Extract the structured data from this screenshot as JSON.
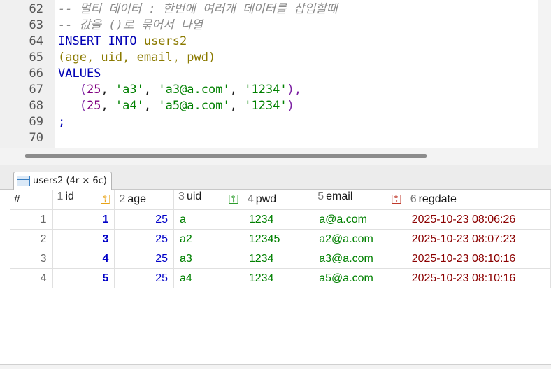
{
  "editor": {
    "lines": [
      {
        "num": "62",
        "parts": [
          {
            "t": "-- 멀티 데이터 : 한번에 여러개 데이터를 삽입할때",
            "c": "cm"
          }
        ]
      },
      {
        "num": "63",
        "parts": [
          {
            "t": "-- 값을 ()로 묶어서 나열",
            "c": "cm"
          }
        ]
      },
      {
        "num": "64",
        "parts": [
          {
            "t": "INSERT INTO ",
            "c": "kw"
          },
          {
            "t": "users2",
            "c": "id"
          }
        ]
      },
      {
        "num": "65",
        "parts": [
          {
            "t": "(",
            "c": "id"
          },
          {
            "t": "age, uid, email, pwd",
            "c": "id"
          },
          {
            "t": ")",
            "c": "id"
          }
        ]
      },
      {
        "num": "66",
        "parts": [
          {
            "t": "VALUES",
            "c": "kw"
          }
        ]
      },
      {
        "num": "67",
        "parts": [
          {
            "t": "   (",
            "c": "pn"
          },
          {
            "t": "25",
            "c": "nm"
          },
          {
            "t": ", ",
            "c": "bl"
          },
          {
            "t": "'a3'",
            "c": "st"
          },
          {
            "t": ", ",
            "c": "bl"
          },
          {
            "t": "'a3@a.com'",
            "c": "st"
          },
          {
            "t": ", ",
            "c": "bl"
          },
          {
            "t": "'1234'",
            "c": "st"
          },
          {
            "t": "),",
            "c": "pn"
          }
        ]
      },
      {
        "num": "68",
        "parts": [
          {
            "t": "   (",
            "c": "pn"
          },
          {
            "t": "25",
            "c": "nm"
          },
          {
            "t": ", ",
            "c": "bl"
          },
          {
            "t": "'a4'",
            "c": "st"
          },
          {
            "t": ", ",
            "c": "bl"
          },
          {
            "t": "'a5@a.com'",
            "c": "st"
          },
          {
            "t": ", ",
            "c": "bl"
          },
          {
            "t": "'1234'",
            "c": "st"
          },
          {
            "t": ")",
            "c": "pn"
          }
        ]
      },
      {
        "num": "69",
        "parts": [
          {
            "t": ";",
            "c": "kw"
          }
        ]
      },
      {
        "num": "70",
        "parts": []
      }
    ]
  },
  "result": {
    "tab_label": "users2 (4r × 6c)",
    "columns": [
      {
        "label": "#",
        "num": "",
        "key": ""
      },
      {
        "label": "id",
        "num": "1",
        "key": "primary"
      },
      {
        "label": "age",
        "num": "2",
        "key": ""
      },
      {
        "label": "uid",
        "num": "3",
        "key": "unique"
      },
      {
        "label": "pwd",
        "num": "4",
        "key": ""
      },
      {
        "label": "email",
        "num": "5",
        "key": "foreign"
      },
      {
        "label": "regdate",
        "num": "6",
        "key": ""
      }
    ],
    "rows": [
      [
        "1",
        "1",
        "25",
        "a",
        "1234",
        "a@a.com",
        "2025-10-23 08:06:26"
      ],
      [
        "2",
        "3",
        "25",
        "a2",
        "12345",
        "a2@a.com",
        "2025-10-23 08:07:23"
      ],
      [
        "3",
        "4",
        "25",
        "a3",
        "1234",
        "a3@a.com",
        "2025-10-23 08:10:16"
      ],
      [
        "4",
        "5",
        "25",
        "a4",
        "1234",
        "a5@a.com",
        "2025-10-23 08:10:16"
      ]
    ]
  },
  "colors": {
    "key_primary": "#e8a317",
    "key_unique": "#2e9e2e",
    "key_foreign": "#c0392b"
  },
  "icons": {
    "tab_icon": "table-grid-icon",
    "key_icon": "key-icon"
  }
}
